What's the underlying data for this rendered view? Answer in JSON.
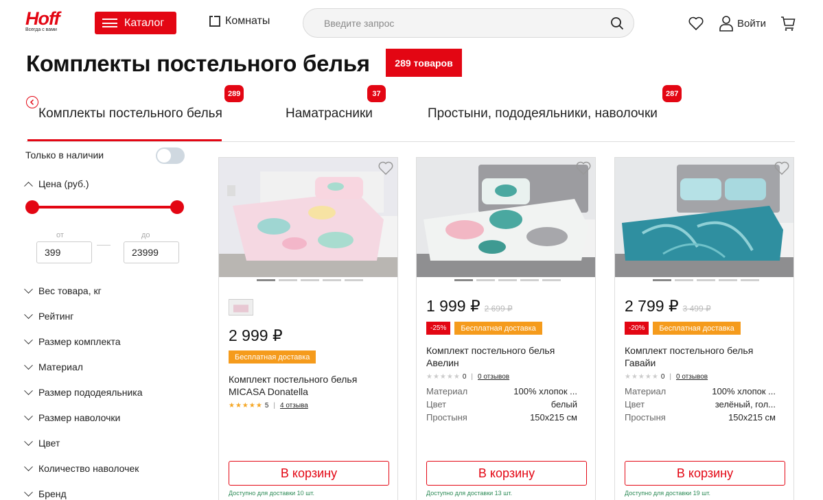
{
  "header": {
    "logo": "Hoff",
    "logo_tagline": "Всегда с вами",
    "catalog_label": "Каталог",
    "rooms_label": "Комнаты",
    "search_placeholder": "Введите запрос",
    "login_label": "Войти"
  },
  "page": {
    "title": "Комплекты постельного белья",
    "count_badge": "289 товаров"
  },
  "tabs": [
    {
      "label": "Комплекты постельного белья",
      "count": "289"
    },
    {
      "label": "Наматрасники",
      "count": "37"
    },
    {
      "label": "Простыни, пододеяльники, наволочки",
      "count": "287"
    }
  ],
  "filters": {
    "in_stock_label": "Только в наличии",
    "in_stock_on": false,
    "price_label": "Цена (руб.)",
    "from_label": "от",
    "to_label": "до",
    "price_from": "399",
    "price_to": "23999",
    "collapsed": [
      "Вес товара, кг",
      "Рейтинг",
      "Размер комплекта",
      "Материал",
      "Размер пододеяльника",
      "Размер наволочки",
      "Цвет",
      "Количество наволочек",
      "Бренд"
    ]
  },
  "products": [
    {
      "price": "2 999 ₽",
      "old_price": "",
      "discount": "",
      "delivery_badge": "Бесплатная доставка",
      "name_line1": "Комплект постельного белья",
      "name_line2": "MICASA Donatella",
      "stars": "★★★★★",
      "rating": "5",
      "reviews": "4 отзыва",
      "specs": [],
      "cart_label": "В корзину",
      "availability": "Доступно для доставки 10 шт."
    },
    {
      "price": "1 999 ₽",
      "old_price": "2 699 ₽",
      "discount": "-25%",
      "delivery_badge": "Бесплатная доставка",
      "name_line1": "Комплект постельного белья",
      "name_line2": "Авелин",
      "stars": "★★★★★",
      "rating": "0",
      "reviews": "0 отзывов",
      "specs": [
        {
          "key": "Материал",
          "value": "100% хлопок ..."
        },
        {
          "key": "Цвет",
          "value": "белый"
        },
        {
          "key": "Простыня",
          "value": "150х215 см"
        }
      ],
      "cart_label": "В корзину",
      "availability": "Доступно для доставки 13 шт."
    },
    {
      "price": "2 799 ₽",
      "old_price": "3 499 ₽",
      "discount": "-20%",
      "delivery_badge": "Бесплатная доставка",
      "name_line1": "Комплект постельного белья",
      "name_line2": "Гавайи",
      "stars": "★★★★★",
      "rating": "0",
      "reviews": "0 отзывов",
      "specs": [
        {
          "key": "Материал",
          "value": "100% хлопок ..."
        },
        {
          "key": "Цвет",
          "value": "зелёный, гол..."
        },
        {
          "key": "Простыня",
          "value": "150х215 см"
        }
      ],
      "cart_label": "В корзину",
      "availability": "Доступно для доставки 19 шт."
    }
  ],
  "colors": {
    "brand_red": "#e30613",
    "delivery_orange": "#f59b1c",
    "availability_green": "#2e8b57"
  }
}
